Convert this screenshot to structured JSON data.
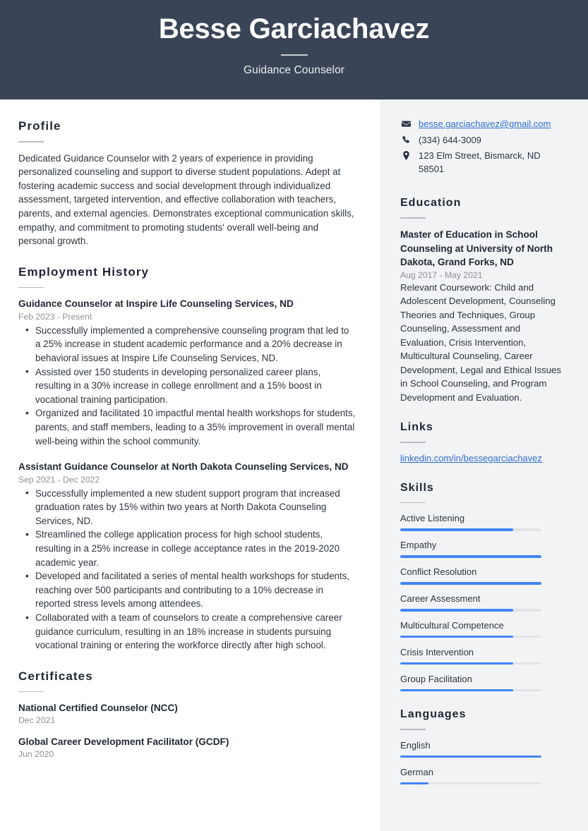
{
  "header": {
    "name": "Besse Garciachavez",
    "job_title": "Guidance Counselor",
    "bg_color": "#394456"
  },
  "accent_color": "#4285f4",
  "link_color": "#2f6fd0",
  "main": {
    "profile": {
      "heading": "Profile",
      "text": "Dedicated Guidance Counselor with 2 years of experience in providing personalized counseling and support to diverse student populations. Adept at fostering academic success and social development through individualized assessment, targeted intervention, and effective collaboration with teachers, parents, and external agencies. Demonstrates exceptional communication skills, empathy, and commitment to promoting students' overall well-being and personal growth."
    },
    "employment": {
      "heading": "Employment History",
      "jobs": [
        {
          "title": "Guidance Counselor at Inspire Life Counseling Services, ND",
          "date": "Feb 2023 - Present",
          "bullets": [
            "Successfully implemented a comprehensive counseling program that led to a 25% increase in student academic performance and a 20% decrease in behavioral issues at Inspire Life Counseling Services, ND.",
            "Assisted over 150 students in developing personalized career plans, resulting in a 30% increase in college enrollment and a 15% boost in vocational training participation.",
            "Organized and facilitated 10 impactful mental health workshops for students, parents, and staff members, leading to a 35% improvement in overall mental well-being within the school community."
          ]
        },
        {
          "title": "Assistant Guidance Counselor at North Dakota Counseling Services, ND",
          "date": "Sep 2021 - Dec 2022",
          "bullets": [
            "Successfully implemented a new student support program that increased graduation rates by 15% within two years at North Dakota Counseling Services, ND.",
            "Streamlined the college application process for high school students, resulting in a 25% increase in college acceptance rates in the 2019-2020 academic year.",
            "Developed and facilitated a series of mental health workshops for students, reaching over 500 participants and contributing to a 10% decrease in reported stress levels among attendees.",
            "Collaborated with a team of counselors to create a comprehensive career guidance curriculum, resulting in an 18% increase in students pursuing vocational training or entering the workforce directly after high school."
          ]
        }
      ]
    },
    "certificates": {
      "heading": "Certificates",
      "items": [
        {
          "title": "National Certified Counselor (NCC)",
          "date": "Dec 2021"
        },
        {
          "title": "Global Career Development Facilitator (GCDF)",
          "date": "Jun 2020"
        }
      ]
    }
  },
  "sidebar": {
    "contact": [
      {
        "icon": "envelope-icon",
        "text": "besse.garciachavez@gmail.com",
        "is_link": true
      },
      {
        "icon": "phone-icon",
        "text": "(334) 644-3009",
        "is_link": false
      },
      {
        "icon": "location-pin-icon",
        "text": "123 Elm Street, Bismarck, ND 58501",
        "is_link": false
      }
    ],
    "education": {
      "heading": "Education",
      "title": "Master of Education in School Counseling at University of North Dakota, Grand Forks, ND",
      "date": "Aug 2017 - May 2021",
      "description": "Relevant Coursework: Child and Adolescent Development, Counseling Theories and Techniques, Group Counseling, Assessment and Evaluation, Crisis Intervention, Multicultural Counseling, Career Development, Legal and Ethical Issues in School Counseling, and Program Development and Evaluation."
    },
    "links": {
      "heading": "Links",
      "items": [
        {
          "label": "linkedin.com/in/bessegarciachavez"
        }
      ]
    },
    "skills": {
      "heading": "Skills",
      "items": [
        {
          "label": "Active Listening",
          "level": 80
        },
        {
          "label": "Empathy",
          "level": 100
        },
        {
          "label": "Conflict Resolution",
          "level": 100
        },
        {
          "label": "Career Assessment",
          "level": 80
        },
        {
          "label": "Multicultural Competence",
          "level": 80
        },
        {
          "label": "Crisis Intervention",
          "level": 80
        },
        {
          "label": "Group Facilitation",
          "level": 80
        }
      ]
    },
    "languages": {
      "heading": "Languages",
      "items": [
        {
          "label": "English",
          "level": 100
        },
        {
          "label": "German",
          "level": 20
        }
      ]
    }
  }
}
